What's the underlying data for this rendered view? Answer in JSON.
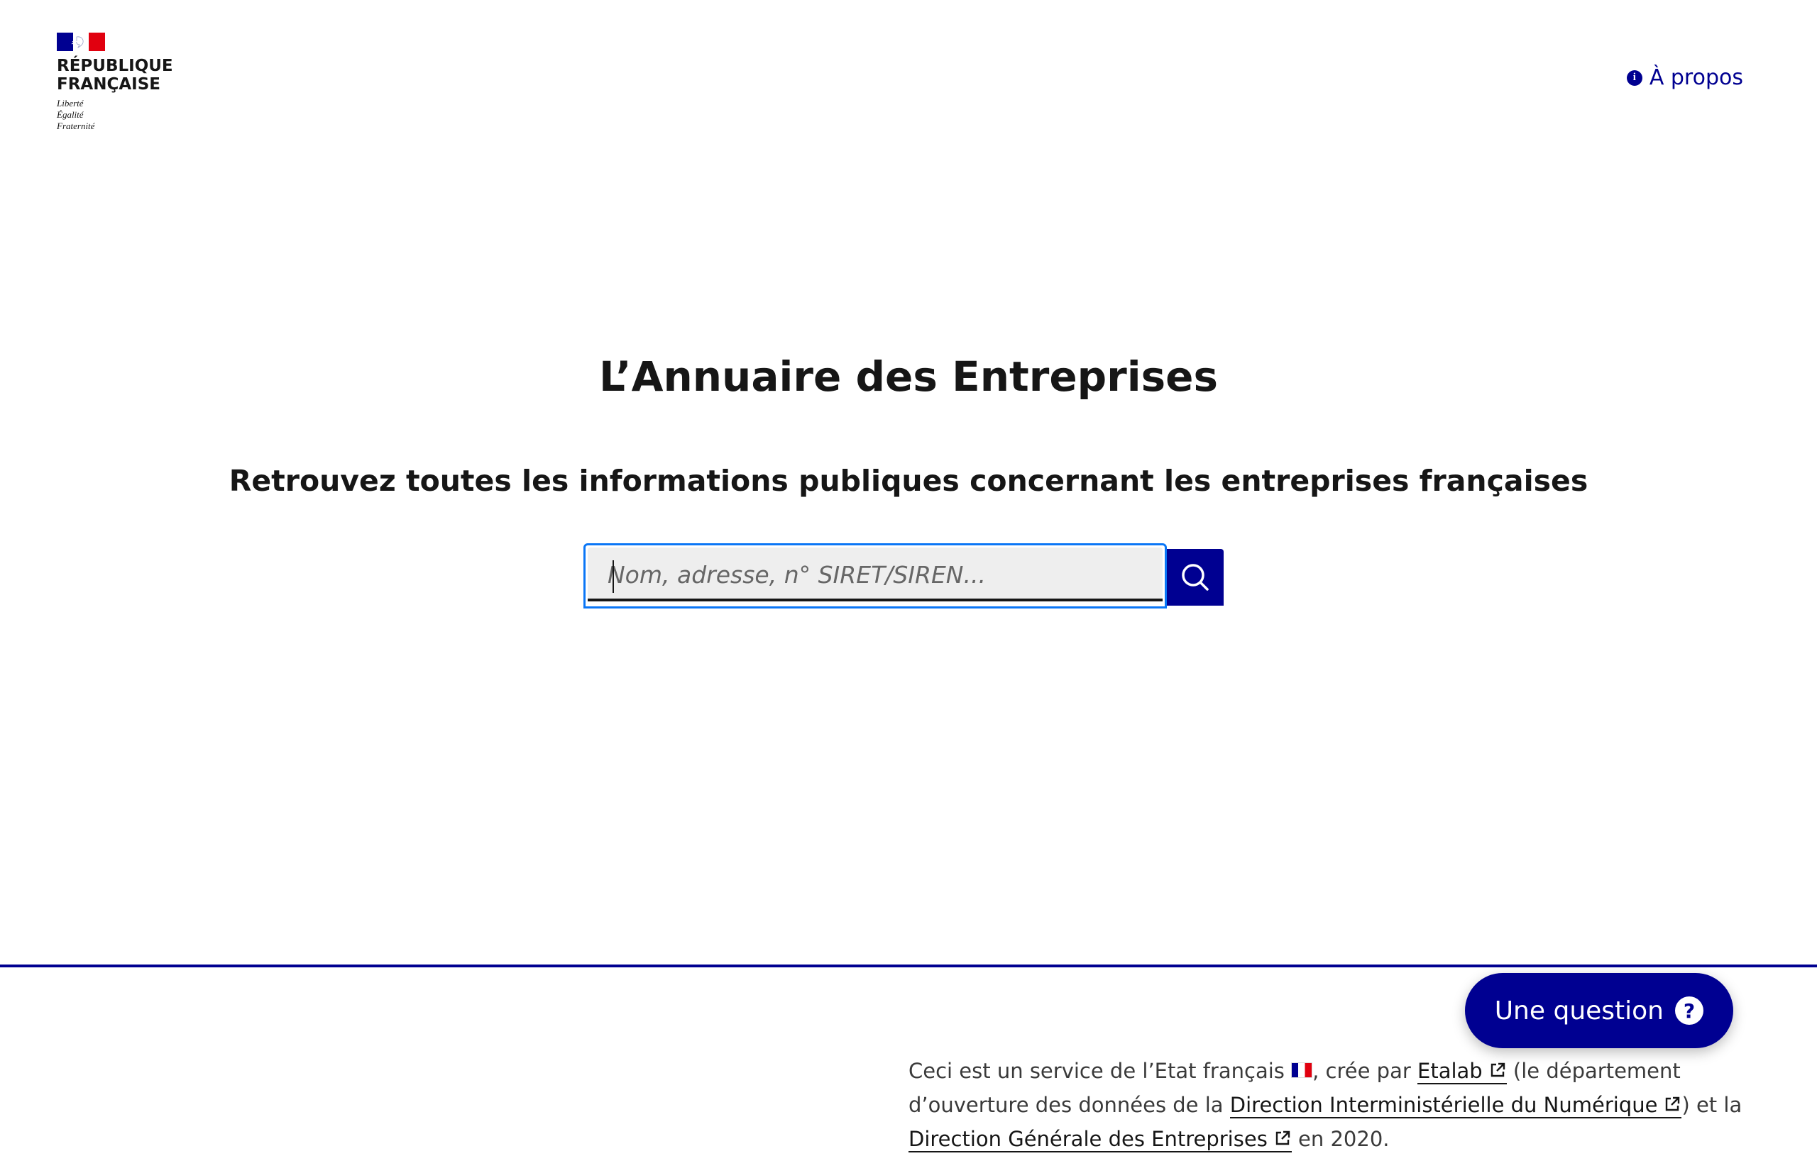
{
  "header": {
    "logo": {
      "title_line1": "RÉPUBLIQUE",
      "title_line2": "FRANÇAISE",
      "motto_line1": "Liberté",
      "motto_line2": "Égalité",
      "motto_line3": "Fraternité"
    },
    "about_link": "À propos"
  },
  "main": {
    "title": "L’Annuaire des Entreprises",
    "subtitle": "Retrouvez toutes les informations publiques concernant les entreprises françaises",
    "search": {
      "placeholder": "Nom, adresse, n° SIRET/SIREN...",
      "value": ""
    }
  },
  "footer": {
    "text_1": "Ceci est un service de l’Etat français ",
    "text_2": ", crée par ",
    "link_etalab": "Etalab",
    "text_3": " (le département d’ouverture des données de la ",
    "link_dinum": "Direction Interministérielle du Numérique",
    "text_4": ") et la ",
    "link_dge": "Direction Générale des Entreprises",
    "text_5": " en 2020."
  },
  "question_button": "Une question",
  "colors": {
    "primary": "#000091",
    "focus": "#0a76f6",
    "marianne_red": "#e1000f",
    "text": "#161616"
  },
  "icons": {
    "about": "info-icon",
    "search": "search-icon",
    "external": "external-link-icon",
    "question": "question-mark-icon"
  }
}
